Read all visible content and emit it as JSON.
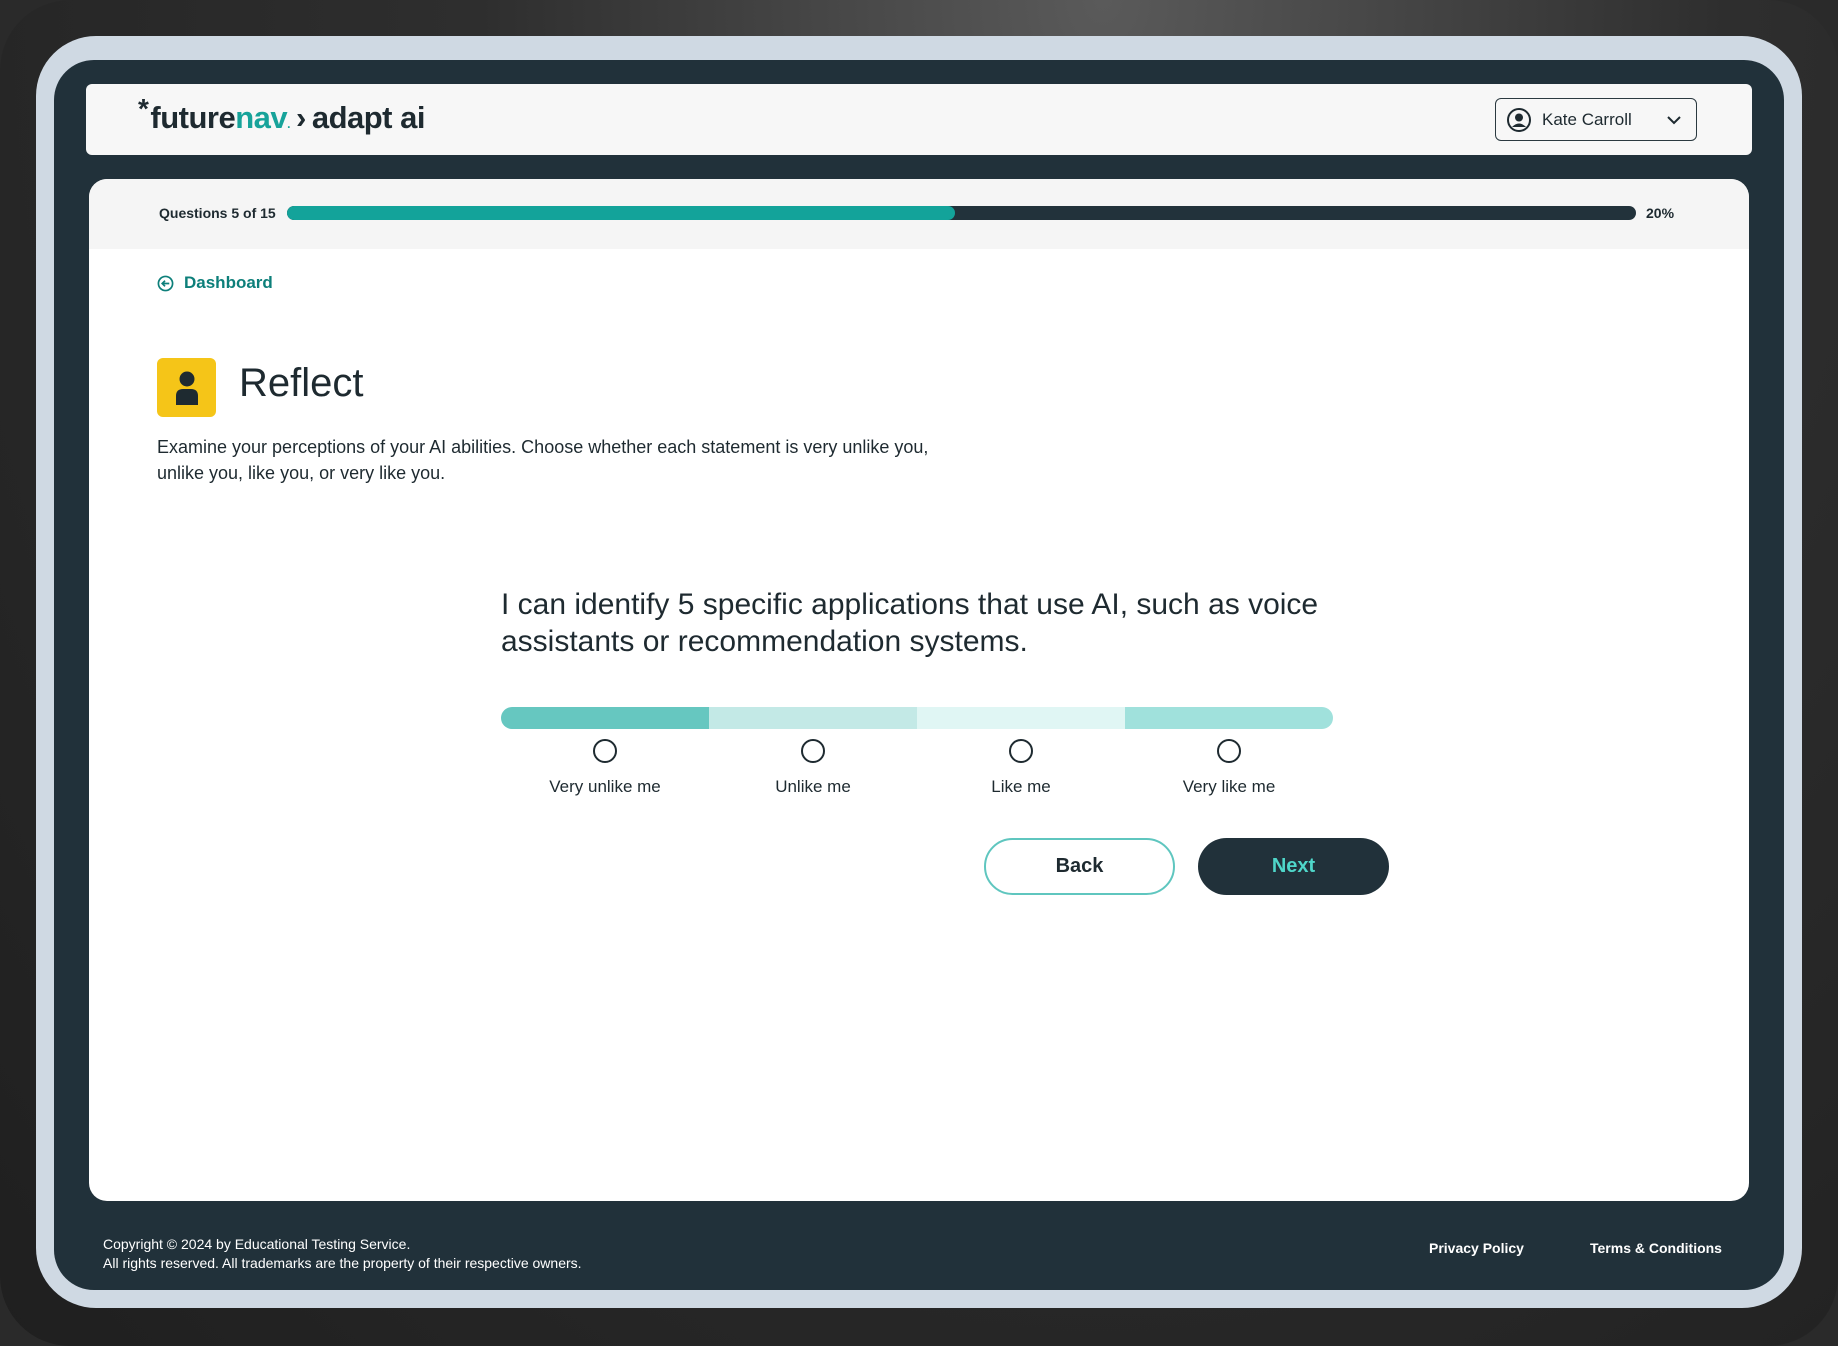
{
  "header": {
    "logo": {
      "prefix": "future",
      "accent": "nav",
      "separator": "›",
      "product": "adapt ai"
    },
    "user": {
      "name": "Kate Carroll",
      "icon": "user-circle-icon",
      "menu_icon": "chevron-down-icon"
    }
  },
  "progress": {
    "label": "Questions 5 of 15",
    "percent_text": "20%",
    "fill_fraction": 0.495
  },
  "nav": {
    "back_label": "Dashboard",
    "back_icon": "arrow-left-circle-icon"
  },
  "section": {
    "icon": "person-icon",
    "title": "Reflect",
    "instructions": "Examine your perceptions of your AI abilities. Choose whether each statement is very unlike you, unlike you, like you, or very like you."
  },
  "question": {
    "text": "I can identify 5 specific applications that use AI, such as voice assistants or recommendation systems.",
    "options": [
      {
        "label": "Very unlike me"
      },
      {
        "label": "Unlike me"
      },
      {
        "label": "Like me"
      },
      {
        "label": "Very like me"
      }
    ],
    "scale_colors": [
      "#66c7c0",
      "#c3e9e6",
      "#e0f6f4",
      "#a0e1dc"
    ]
  },
  "buttons": {
    "back": "Back",
    "next": "Next"
  },
  "footer": {
    "copyright_line1": "Copyright © 2024 by Educational Testing Service.",
    "copyright_line2": "All rights reserved. All trademarks are the property of their respective owners.",
    "privacy": "Privacy Policy",
    "terms": "Terms & Conditions"
  },
  "colors": {
    "teal": "#13a39a",
    "dark": "#21313a",
    "icon_yellow": "#f5c518",
    "link_teal": "#0d7f7a"
  }
}
